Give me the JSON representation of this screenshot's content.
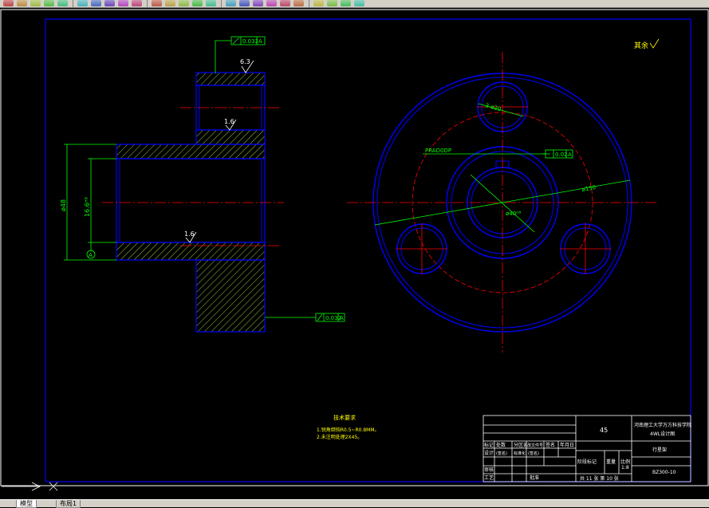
{
  "toolbar": {
    "buttons": [
      "new",
      "open",
      "save",
      "print",
      "preview",
      "cut",
      "copy",
      "paste",
      "match",
      "undo",
      "redo",
      "pan",
      "zoom-realtime",
      "zoom-window",
      "zoom-previous",
      "properties",
      "design-center",
      "tool-palettes",
      "markup",
      "calc",
      "help",
      "layer-manager",
      "layer-state",
      "layer-on",
      "layer-freeze"
    ],
    "icons": [
      "new-file-icon",
      "open-folder-icon",
      "save-icon",
      "print-icon",
      "print-preview-icon",
      "cut-icon",
      "copy-icon",
      "paste-icon",
      "match-properties-icon",
      "undo-icon",
      "redo-icon",
      "pan-icon",
      "zoom-realtime-icon",
      "zoom-window-icon",
      "zoom-previous-icon",
      "properties-icon",
      "design-center-icon",
      "tool-palettes-icon",
      "markup-icon",
      "calculator-icon",
      "help-icon",
      "layer-manager-icon",
      "layer-state-icon",
      "layer-on-icon",
      "layer-freeze-icon"
    ]
  },
  "drawing": {
    "roughness_note": "其余",
    "tolerance_top": "0.032",
    "tolerance_top_datum": "A",
    "roughness_63": "6.3",
    "roughness_16_a": "1.6",
    "roughness_16_b": "1.6",
    "dim_d48": "ø48",
    "dim_d16": "16.6ᴴ⁸",
    "datum_a": "A",
    "tolerance_bottom": "0.032",
    "tolerance_bottom_datum": "A",
    "dim_holes": "3-ø20",
    "dim_pcd": "PRAD0DP",
    "tolerance_pos": "0.02",
    "tolerance_pos_datum": "A",
    "dim_d150": "ø150",
    "dim_d40": "ø40ᴴ⁸",
    "tech_title": "技术要求",
    "tech_line1": "1.锐角倒钝R0.5~R0.8MM。",
    "tech_line2": "2.未注明处理2X45。"
  },
  "title_block": {
    "material": "45",
    "school": "河南理工大学万方科技学院",
    "design_title": "4WL设计图",
    "part_name": "行星架",
    "scale": "1:8",
    "drawing_no": "BZ300-10",
    "sheet_info": "共 11 张  第 10 张",
    "header_cols": [
      "标记",
      "处数",
      "分区",
      "更改文件号",
      "签名",
      "年月日"
    ],
    "designer_row": [
      "设计",
      "(签名)",
      "标准化",
      "(签名)"
    ],
    "rows_left": [
      "审核",
      "工艺"
    ],
    "approve_label": "批准",
    "stage_labels": [
      "阶段标记",
      "重量",
      "比例"
    ]
  },
  "status": {
    "tab_model": "模型",
    "tab_layout": "布局1"
  },
  "colors": {
    "background": "#000000",
    "frame": "#0000ff",
    "centerline": "#ff0000",
    "dimension": "#00ff00",
    "hatch": "#99cc33",
    "text_yellow": "#ffff00",
    "toolbar": "#d4d0c8"
  }
}
